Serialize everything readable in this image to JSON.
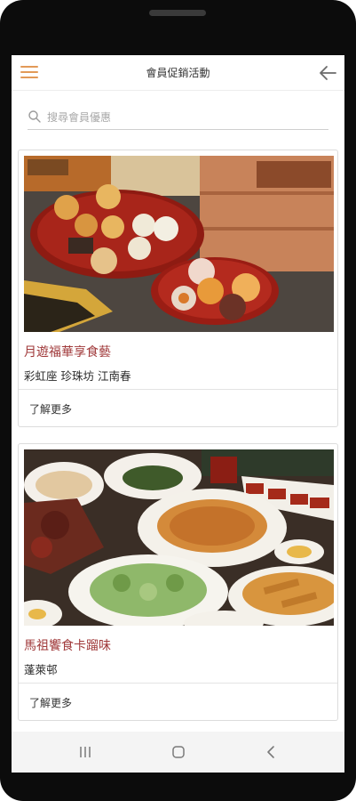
{
  "header": {
    "title": "會員促銷活動",
    "menu_icon": "hamburger-menu-icon",
    "back_icon": "arrow-left-icon",
    "accent_color": "#e29a58"
  },
  "search": {
    "placeholder": "搜尋會員優惠",
    "value": "",
    "icon": "search-icon"
  },
  "promotions": [
    {
      "title": "月遊福華享食藝",
      "subtitle": "彩虹座 珍珠坊 江南春",
      "link_label": "了解更多",
      "image": "mooncakes-photo"
    },
    {
      "title": "馬祖饗食卡蹓味",
      "subtitle": "蓬萊邨",
      "link_label": "了解更多",
      "image": "banquet-dishes-photo"
    }
  ],
  "colors": {
    "title": "#a0393a",
    "text": "#2a2a2a",
    "border": "#dcdcdc"
  },
  "system_nav": {
    "recent": "recent-apps-icon",
    "home": "home-icon",
    "back": "back-chevron-icon"
  }
}
